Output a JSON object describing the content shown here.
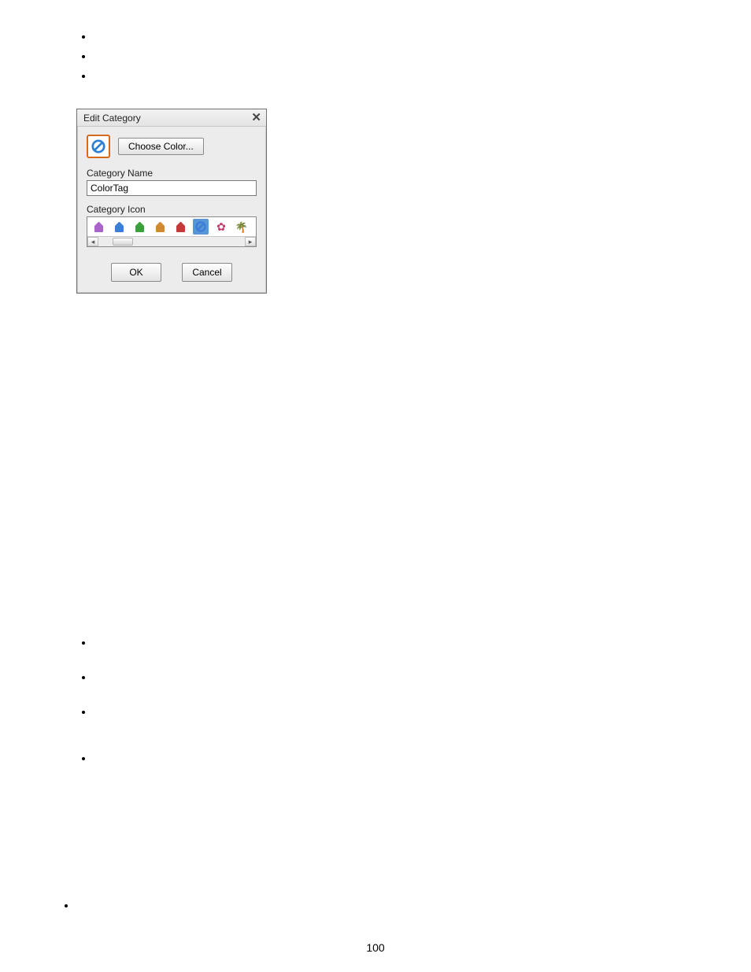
{
  "doc": {
    "page_number": "100"
  },
  "dialog": {
    "title": "Edit Category",
    "choose_color_label": "Choose Color...",
    "name_label": "Category Name",
    "name_value": "ColorTag",
    "icon_label": "Category Icon",
    "ok_label": "OK",
    "cancel_label": "Cancel",
    "icons": [
      {
        "type": "tag",
        "color": "#a864c8"
      },
      {
        "type": "tag",
        "color": "#3a7fd6"
      },
      {
        "type": "tag",
        "color": "#3aa03a"
      },
      {
        "type": "tag",
        "color": "#d08a30"
      },
      {
        "type": "tag",
        "color": "#c23a3a"
      },
      {
        "type": "circle",
        "color": "#3a7fd6",
        "selected": true
      },
      {
        "type": "flower",
        "color": "#c23a6b"
      },
      {
        "type": "palm",
        "color": "#3a7a3a"
      }
    ]
  }
}
